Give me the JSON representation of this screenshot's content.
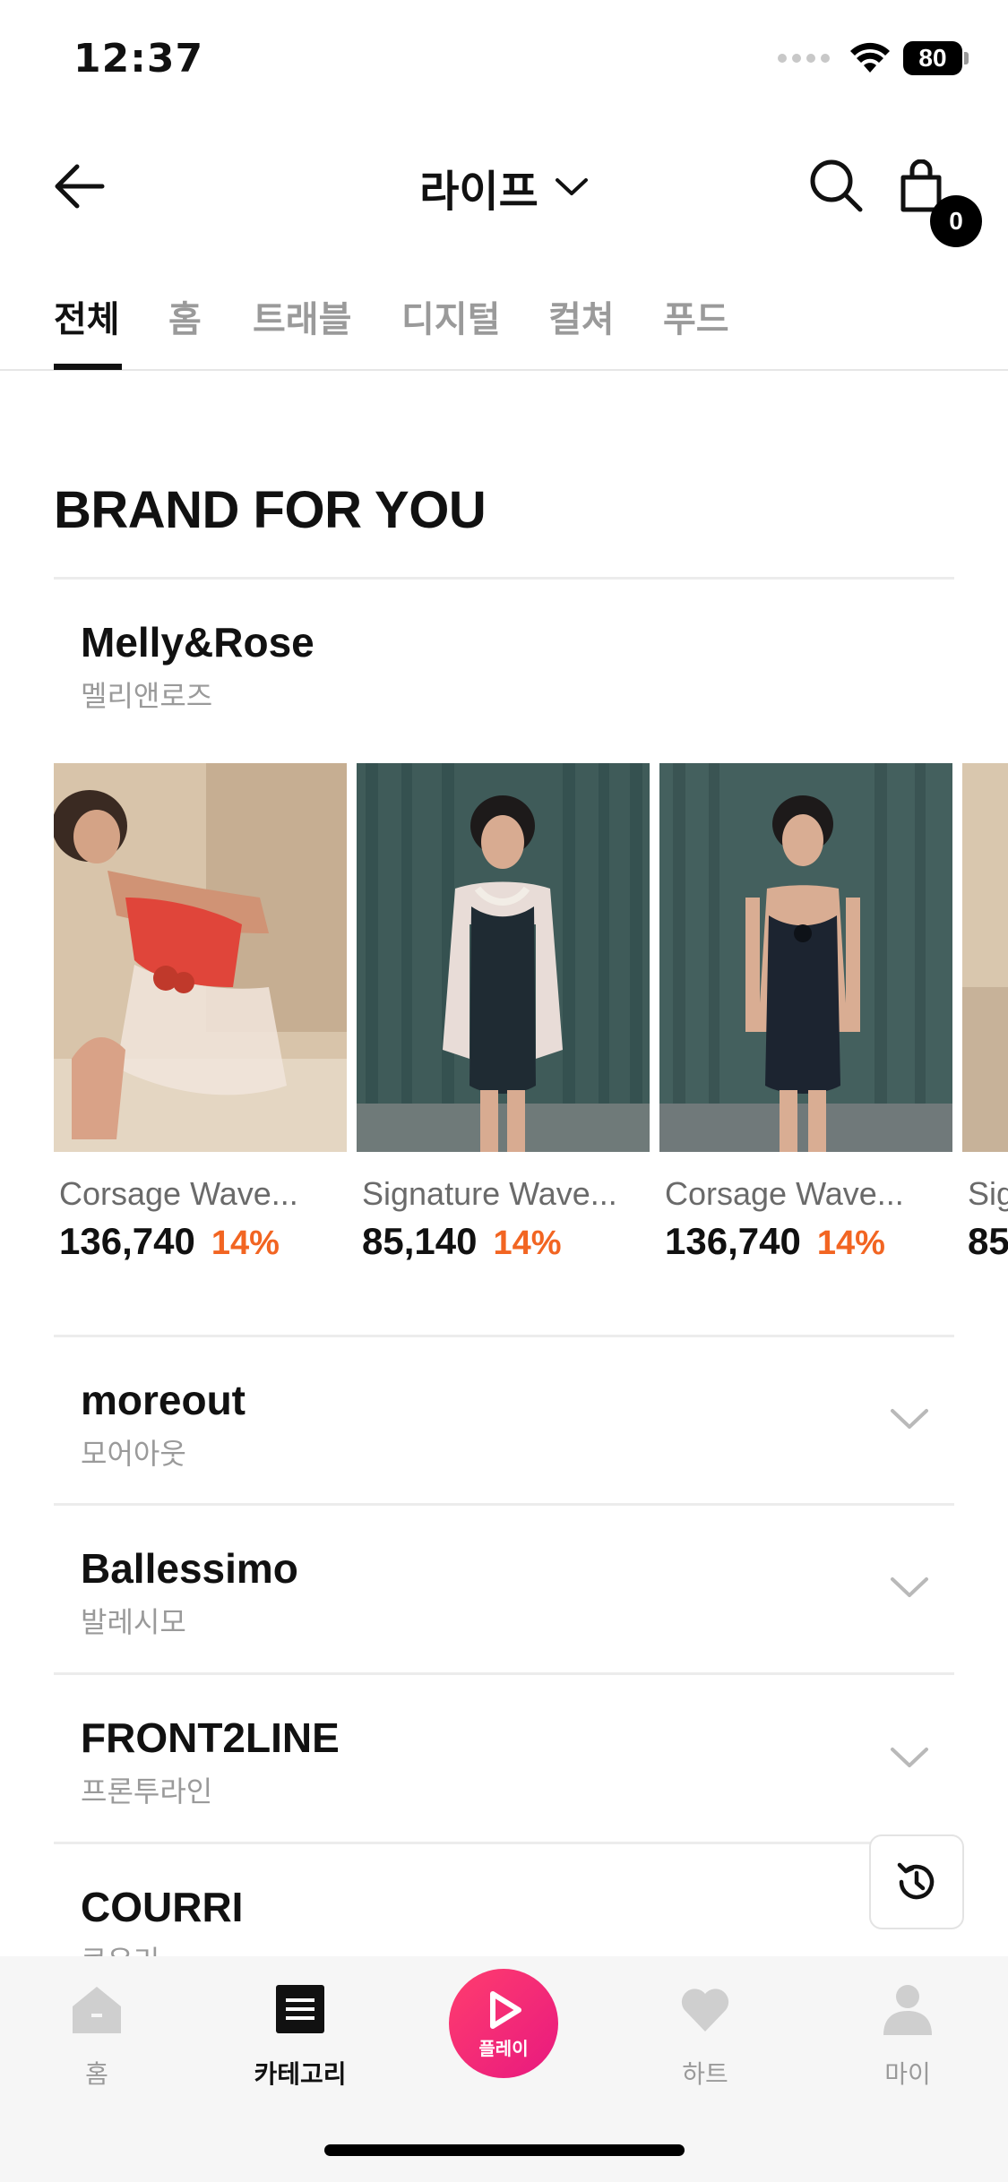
{
  "status_bar": {
    "time": "12:37",
    "battery": "80"
  },
  "header": {
    "title": "라이프",
    "cart_count": "0"
  },
  "tabs": [
    {
      "label": "전체",
      "active": true
    },
    {
      "label": "홈",
      "active": false
    },
    {
      "label": "트래블",
      "active": false
    },
    {
      "label": "디지털",
      "active": false
    },
    {
      "label": "컬쳐",
      "active": false
    },
    {
      "label": "푸드",
      "active": false
    }
  ],
  "section": {
    "title": "BRAND FOR YOU"
  },
  "brands": [
    {
      "name": "Melly&Rose",
      "sub": "멜리앤로즈",
      "expanded": true,
      "products": [
        {
          "name": "Corsage Wave...",
          "price": "136,740",
          "discount": "14%"
        },
        {
          "name": "Signature Wave...",
          "price": "85,140",
          "discount": "14%"
        },
        {
          "name": "Corsage Wave...",
          "price": "136,740",
          "discount": "14%"
        },
        {
          "name": "Sig",
          "price": "85",
          "discount": ""
        }
      ]
    },
    {
      "name": "moreout",
      "sub": "모어아웃",
      "expanded": false
    },
    {
      "name": "Ballessimo",
      "sub": "발레시모",
      "expanded": false
    },
    {
      "name": "FRONT2LINE",
      "sub": "프론투라인",
      "expanded": false
    },
    {
      "name": "COURRI",
      "sub": "쿠우리",
      "expanded": false
    }
  ],
  "bottom_nav": {
    "home": "홈",
    "category": "카테고리",
    "play": "플레이",
    "heart": "하트",
    "my": "마이"
  },
  "colors": {
    "accent": "#f26522",
    "play": "#e8197f"
  }
}
